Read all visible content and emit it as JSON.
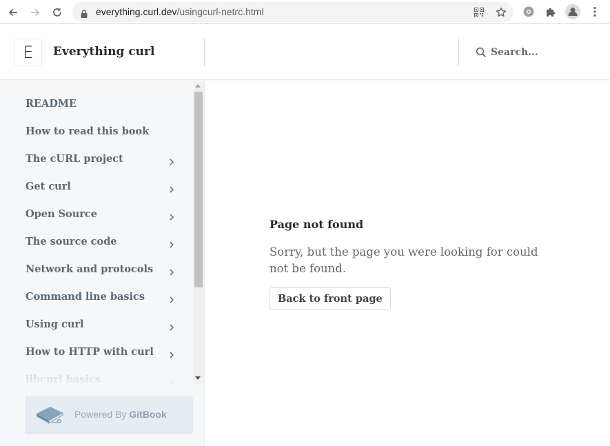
{
  "browser": {
    "url_domain": "everything.curl.dev",
    "url_path": "/usingcurl-netrc.html"
  },
  "header": {
    "logo_letter": "E",
    "site_title": "Everything curl",
    "search_placeholder": "Search..."
  },
  "sidebar": {
    "items": [
      {
        "label": "README",
        "has_chevron": false
      },
      {
        "label": "How to read this book",
        "has_chevron": false
      },
      {
        "label": "The cURL project",
        "has_chevron": true
      },
      {
        "label": "Get curl",
        "has_chevron": true
      },
      {
        "label": "Open Source",
        "has_chevron": true
      },
      {
        "label": "The source code",
        "has_chevron": true
      },
      {
        "label": "Network and protocols",
        "has_chevron": true
      },
      {
        "label": "Command line basics",
        "has_chevron": true
      },
      {
        "label": "Using curl",
        "has_chevron": true
      },
      {
        "label": "How to HTTP with curl",
        "has_chevron": true
      },
      {
        "label": "libcurl basics",
        "has_chevron": true
      }
    ],
    "powered_prefix": "Powered By",
    "powered_brand": "GitBook"
  },
  "main": {
    "title": "Page not found",
    "message": "Sorry, but the page you were looking for could not be found.",
    "back_button": "Back to front page"
  }
}
